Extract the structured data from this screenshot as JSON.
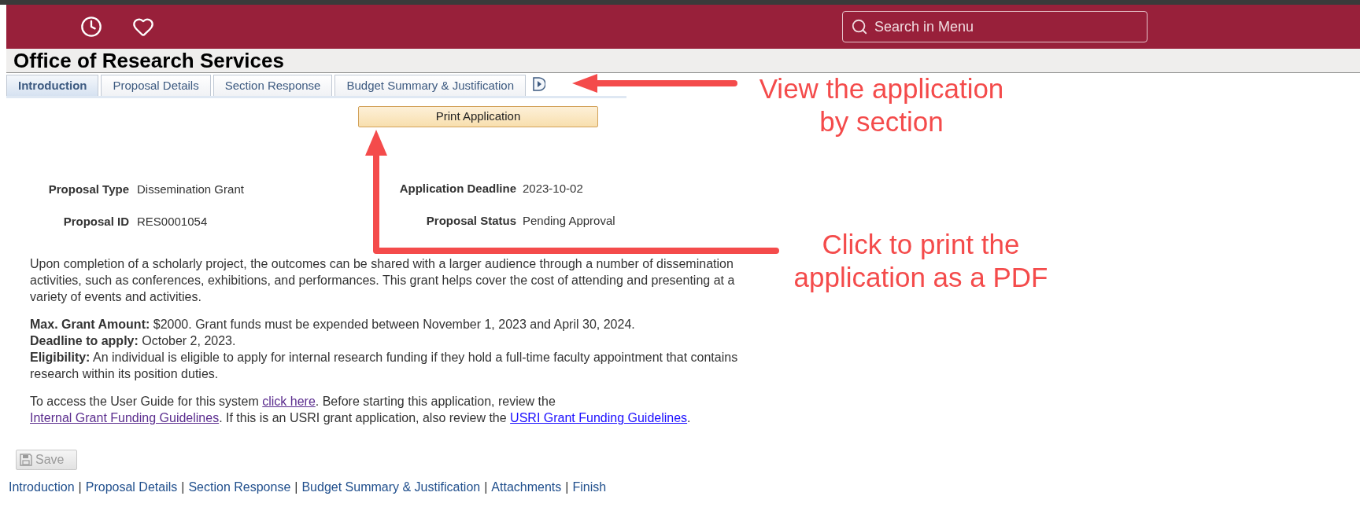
{
  "header": {
    "search": {
      "placeholder": "Search in Menu"
    }
  },
  "title": "Office of Research Services",
  "tabs": [
    {
      "label": "Introduction",
      "selected": true
    },
    {
      "label": "Proposal Details",
      "selected": false
    },
    {
      "label": "Section Response",
      "selected": false
    },
    {
      "label": "Budget Summary & Justification",
      "selected": false
    }
  ],
  "print_button": "Print Application",
  "fields": {
    "left": [
      {
        "label": "Proposal Type",
        "value": "Dissemination Grant"
      },
      {
        "label": "Proposal ID",
        "value": "RES0001054"
      }
    ],
    "right": [
      {
        "label": "Application Deadline",
        "value": "2023-10-02"
      },
      {
        "label": "Proposal Status",
        "value": "Pending Approval"
      }
    ]
  },
  "description": "Upon completion of a scholarly project, the outcomes can be shared with a larger audience through a number of dissemination activities, such as conferences, exhibitions, and performances. This grant helps cover the cost of attending and presenting at a variety of events and activities.",
  "details": [
    "**Max. Grant Amount:** $2000. Grant funds must be expended between November 1, 2023 and April 30, 2024.",
    "**Deadline to apply:** October 2, 2023.",
    "**Eligibility:** An individual is eligible to apply for internal research funding if they hold a full-time faculty appointment that contains research within its position duties."
  ],
  "guide": [
    {
      "kind": "text",
      "text": "To access the User Guide for this system "
    },
    {
      "kind": "link",
      "text": "click here",
      "visited": true
    },
    {
      "kind": "text",
      "text": ". Before starting this application, review the "
    },
    {
      "kind": "link",
      "text": "Internal Grant Funding Guidelines",
      "visited": true
    },
    {
      "kind": "text",
      "text": ". If this is an USRI grant application, also review the "
    },
    {
      "kind": "link",
      "text": "USRI Grant Funding Guidelines",
      "visited": false
    },
    {
      "kind": "text",
      "text": "."
    }
  ],
  "save_button": {
    "label": "Save",
    "disabled": true
  },
  "footer_nav": {
    "separator": "|",
    "links": [
      "Introduction",
      "Proposal Details",
      "Section Response",
      "Budget Summary & Justification",
      "Attachments",
      "Finish"
    ]
  },
  "annotations": [
    {
      "text": "View the application\nby section"
    },
    {
      "text": "Click to print the\napplication as a PDF"
    }
  ]
}
